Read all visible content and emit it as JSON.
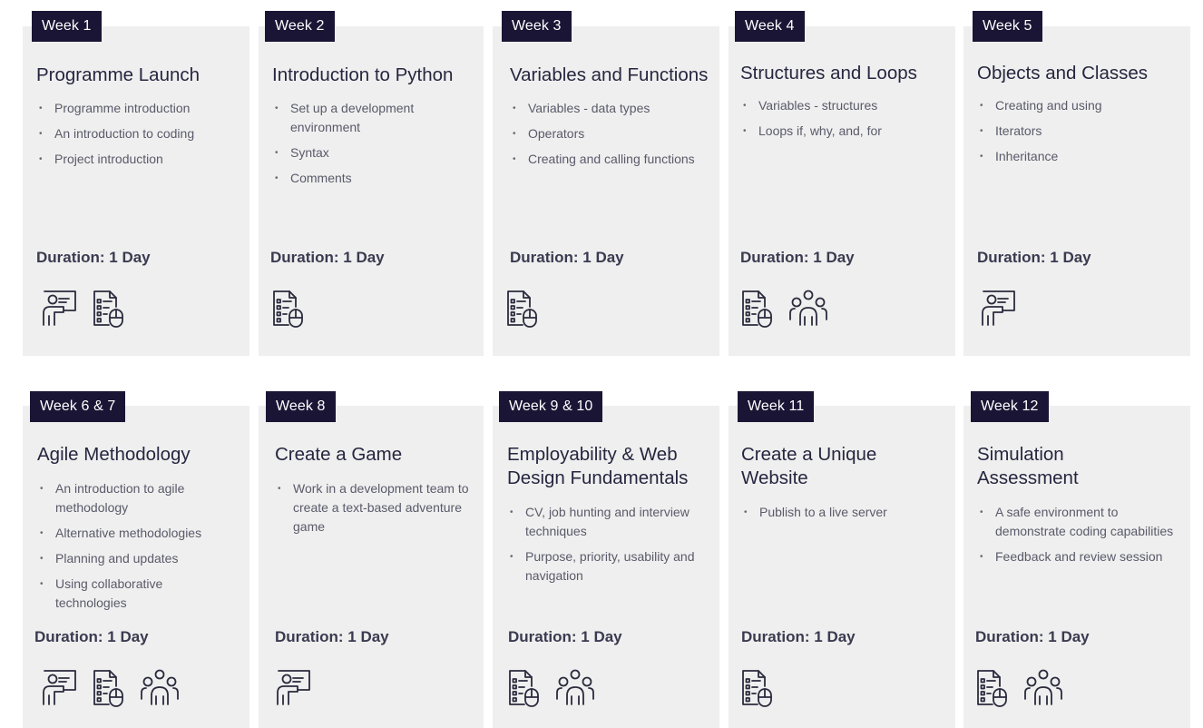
{
  "cards": [
    {
      "week": "Week 1",
      "title": "Programme Launch",
      "bullets": [
        "Programme introduction",
        "An introduction to coding",
        "Project introduction"
      ],
      "duration": "Duration: 1 Day",
      "icons": [
        "presenter-icon",
        "online-form-icon"
      ]
    },
    {
      "week": "Week 2",
      "title": "Introduction to Python",
      "bullets": [
        "Set up a development environment",
        "Syntax",
        "Comments"
      ],
      "duration": "Duration: 1 Day",
      "icons": [
        "online-form-icon"
      ]
    },
    {
      "week": "Week 3",
      "title": "Variables and Functions",
      "bullets": [
        "Variables - data types",
        "Operators",
        "Creating and calling functions"
      ],
      "duration": "Duration: 1 Day",
      "icons": [
        "online-form-icon"
      ]
    },
    {
      "week": "Week 4",
      "title": "Structures and Loops",
      "bullets": [
        "Variables - structures",
        "Loops  if, why, and, for"
      ],
      "duration": "Duration: 1 Day",
      "icons": [
        "online-form-icon",
        "team-icon"
      ]
    },
    {
      "week": "Week 5",
      "title": "Objects and Classes",
      "bullets": [
        "Creating and using",
        "Iterators",
        "Inheritance"
      ],
      "duration": "Duration: 1 Day",
      "icons": [
        "presenter-icon"
      ]
    },
    {
      "week": "Week 6 & 7",
      "title": "Agile Methodology",
      "bullets": [
        "An introduction to agile methodology",
        "Alternative methodologies",
        "Planning and updates",
        "Using collaborative technologies"
      ],
      "duration": "Duration: 1 Day",
      "icons": [
        "presenter-icon",
        "online-form-icon",
        "team-icon"
      ]
    },
    {
      "week": "Week 8",
      "title": "Create a Game",
      "bullets": [
        "Work in a development team to create a text-based adventure game"
      ],
      "duration": "Duration: 1 Day",
      "icons": [
        "presenter-icon"
      ]
    },
    {
      "week": "Week 9 & 10",
      "title": "Employability & Web Design Fundamentals",
      "bullets": [
        "CV, job hunting and interview techniques",
        "Purpose, priority, usability and navigation"
      ],
      "duration": "Duration: 1 Day",
      "icons": [
        "online-form-icon",
        "team-icon"
      ]
    },
    {
      "week": "Week 11",
      "title": "Create a Unique Website",
      "bullets": [
        "Publish to a live server"
      ],
      "duration": "Duration: 1 Day",
      "icons": [
        "online-form-icon"
      ]
    },
    {
      "week": "Week 12",
      "title": "Simulation Assessment",
      "bullets": [
        "A safe environment to demonstrate coding capabilities",
        "Feedback and review session"
      ],
      "duration": "Duration: 1 Day",
      "icons": [
        "online-form-icon",
        "team-icon"
      ]
    }
  ]
}
